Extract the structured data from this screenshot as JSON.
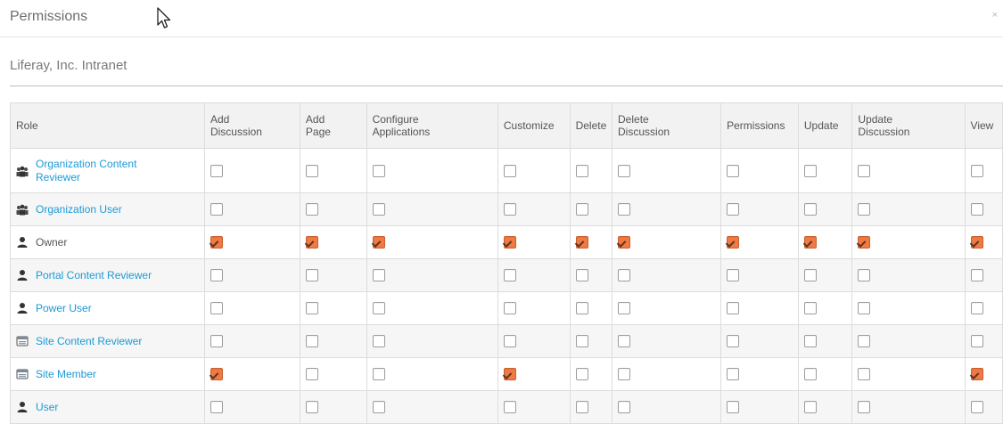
{
  "dialog": {
    "title": "Permissions",
    "close_glyph": "×"
  },
  "subtitle": "Liferay, Inc. Intranet",
  "columns": [
    "Role",
    "Add Discussion",
    "Add Page",
    "Configure Applications",
    "Customize",
    "Delete",
    "Delete Discussion",
    "Permissions",
    "Update",
    "Update Discussion",
    "View"
  ],
  "column_lines": [
    [
      "Role"
    ],
    [
      "Add",
      "Discussion"
    ],
    [
      "Add",
      "Page"
    ],
    [
      "Configure",
      "Applications"
    ],
    [
      "Customize"
    ],
    [
      "Delete"
    ],
    [
      "Delete",
      "Discussion"
    ],
    [
      "Permissions"
    ],
    [
      "Update"
    ],
    [
      "Update",
      "Discussion"
    ],
    [
      "View"
    ]
  ],
  "rows": [
    {
      "role": "Organization Content Reviewer",
      "role_lines": [
        "Organization Content",
        "Reviewer"
      ],
      "icon": "organization-icon",
      "link": true,
      "checks": [
        false,
        false,
        false,
        false,
        false,
        false,
        false,
        false,
        false,
        false
      ]
    },
    {
      "role": "Organization User",
      "role_lines": [
        "Organization User"
      ],
      "icon": "organization-icon",
      "link": true,
      "checks": [
        false,
        false,
        false,
        false,
        false,
        false,
        false,
        false,
        false,
        false
      ]
    },
    {
      "role": "Owner",
      "role_lines": [
        "Owner"
      ],
      "icon": "user-icon",
      "link": false,
      "checks": [
        true,
        true,
        true,
        true,
        true,
        true,
        true,
        true,
        true,
        true
      ]
    },
    {
      "role": "Portal Content Reviewer",
      "role_lines": [
        "Portal Content Reviewer"
      ],
      "icon": "user-icon",
      "link": true,
      "checks": [
        false,
        false,
        false,
        false,
        false,
        false,
        false,
        false,
        false,
        false
      ]
    },
    {
      "role": "Power User",
      "role_lines": [
        "Power User"
      ],
      "icon": "user-icon",
      "link": true,
      "checks": [
        false,
        false,
        false,
        false,
        false,
        false,
        false,
        false,
        false,
        false
      ]
    },
    {
      "role": "Site Content Reviewer",
      "role_lines": [
        "Site Content Reviewer"
      ],
      "icon": "site-icon",
      "link": true,
      "checks": [
        false,
        false,
        false,
        false,
        false,
        false,
        false,
        false,
        false,
        false
      ]
    },
    {
      "role": "Site Member",
      "role_lines": [
        "Site Member"
      ],
      "icon": "site-icon",
      "link": true,
      "checks": [
        true,
        false,
        false,
        true,
        false,
        false,
        false,
        false,
        false,
        true
      ]
    },
    {
      "role": "User",
      "role_lines": [
        "User"
      ],
      "icon": "user-icon",
      "link": true,
      "checks": [
        false,
        false,
        false,
        false,
        false,
        false,
        false,
        false,
        false,
        false
      ]
    }
  ],
  "colors": {
    "link": "#1b9ad6",
    "checked": "#f07a43",
    "header_bg": "#f2f2f2"
  }
}
